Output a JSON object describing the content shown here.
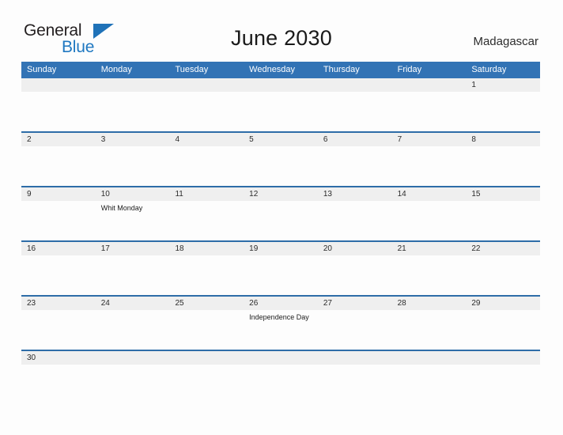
{
  "brand": {
    "word_one": "General",
    "word_two": "Blue",
    "flag_icon": "triangle-flag-icon",
    "color_dark": "#231f20",
    "color_blue": "#1f78c1"
  },
  "header": {
    "month_title": "June 2030",
    "country": "Madagascar"
  },
  "theme": {
    "header_blue": "#3273b5",
    "row_divider_blue": "#2e6da8",
    "date_band_gray": "#efefef",
    "page_background": "#fdfdfd"
  },
  "calendar": {
    "weekdays": [
      "Sunday",
      "Monday",
      "Tuesday",
      "Wednesday",
      "Thursday",
      "Friday",
      "Saturday"
    ],
    "weeks": [
      {
        "dates": [
          "",
          "",
          "",
          "",
          "",
          "",
          "1"
        ],
        "events": [
          "",
          "",
          "",
          "",
          "",
          "",
          ""
        ]
      },
      {
        "dates": [
          "2",
          "3",
          "4",
          "5",
          "6",
          "7",
          "8"
        ],
        "events": [
          "",
          "",
          "",
          "",
          "",
          "",
          ""
        ]
      },
      {
        "dates": [
          "9",
          "10",
          "11",
          "12",
          "13",
          "14",
          "15"
        ],
        "events": [
          "",
          "Whit Monday",
          "",
          "",
          "",
          "",
          ""
        ]
      },
      {
        "dates": [
          "16",
          "17",
          "18",
          "19",
          "20",
          "21",
          "22"
        ],
        "events": [
          "",
          "",
          "",
          "",
          "",
          "",
          ""
        ]
      },
      {
        "dates": [
          "23",
          "24",
          "25",
          "26",
          "27",
          "28",
          "29"
        ],
        "events": [
          "",
          "",
          "",
          "Independence Day",
          "",
          "",
          ""
        ]
      },
      {
        "dates": [
          "30",
          "",
          "",
          "",
          "",
          "",
          ""
        ],
        "events": [
          "",
          "",
          "",
          "",
          "",
          "",
          ""
        ],
        "short": true
      }
    ],
    "holidays": [
      {
        "date": "10",
        "name": "Whit Monday",
        "weekday": "Monday"
      },
      {
        "date": "26",
        "name": "Independence Day",
        "weekday": "Wednesday"
      }
    ]
  }
}
